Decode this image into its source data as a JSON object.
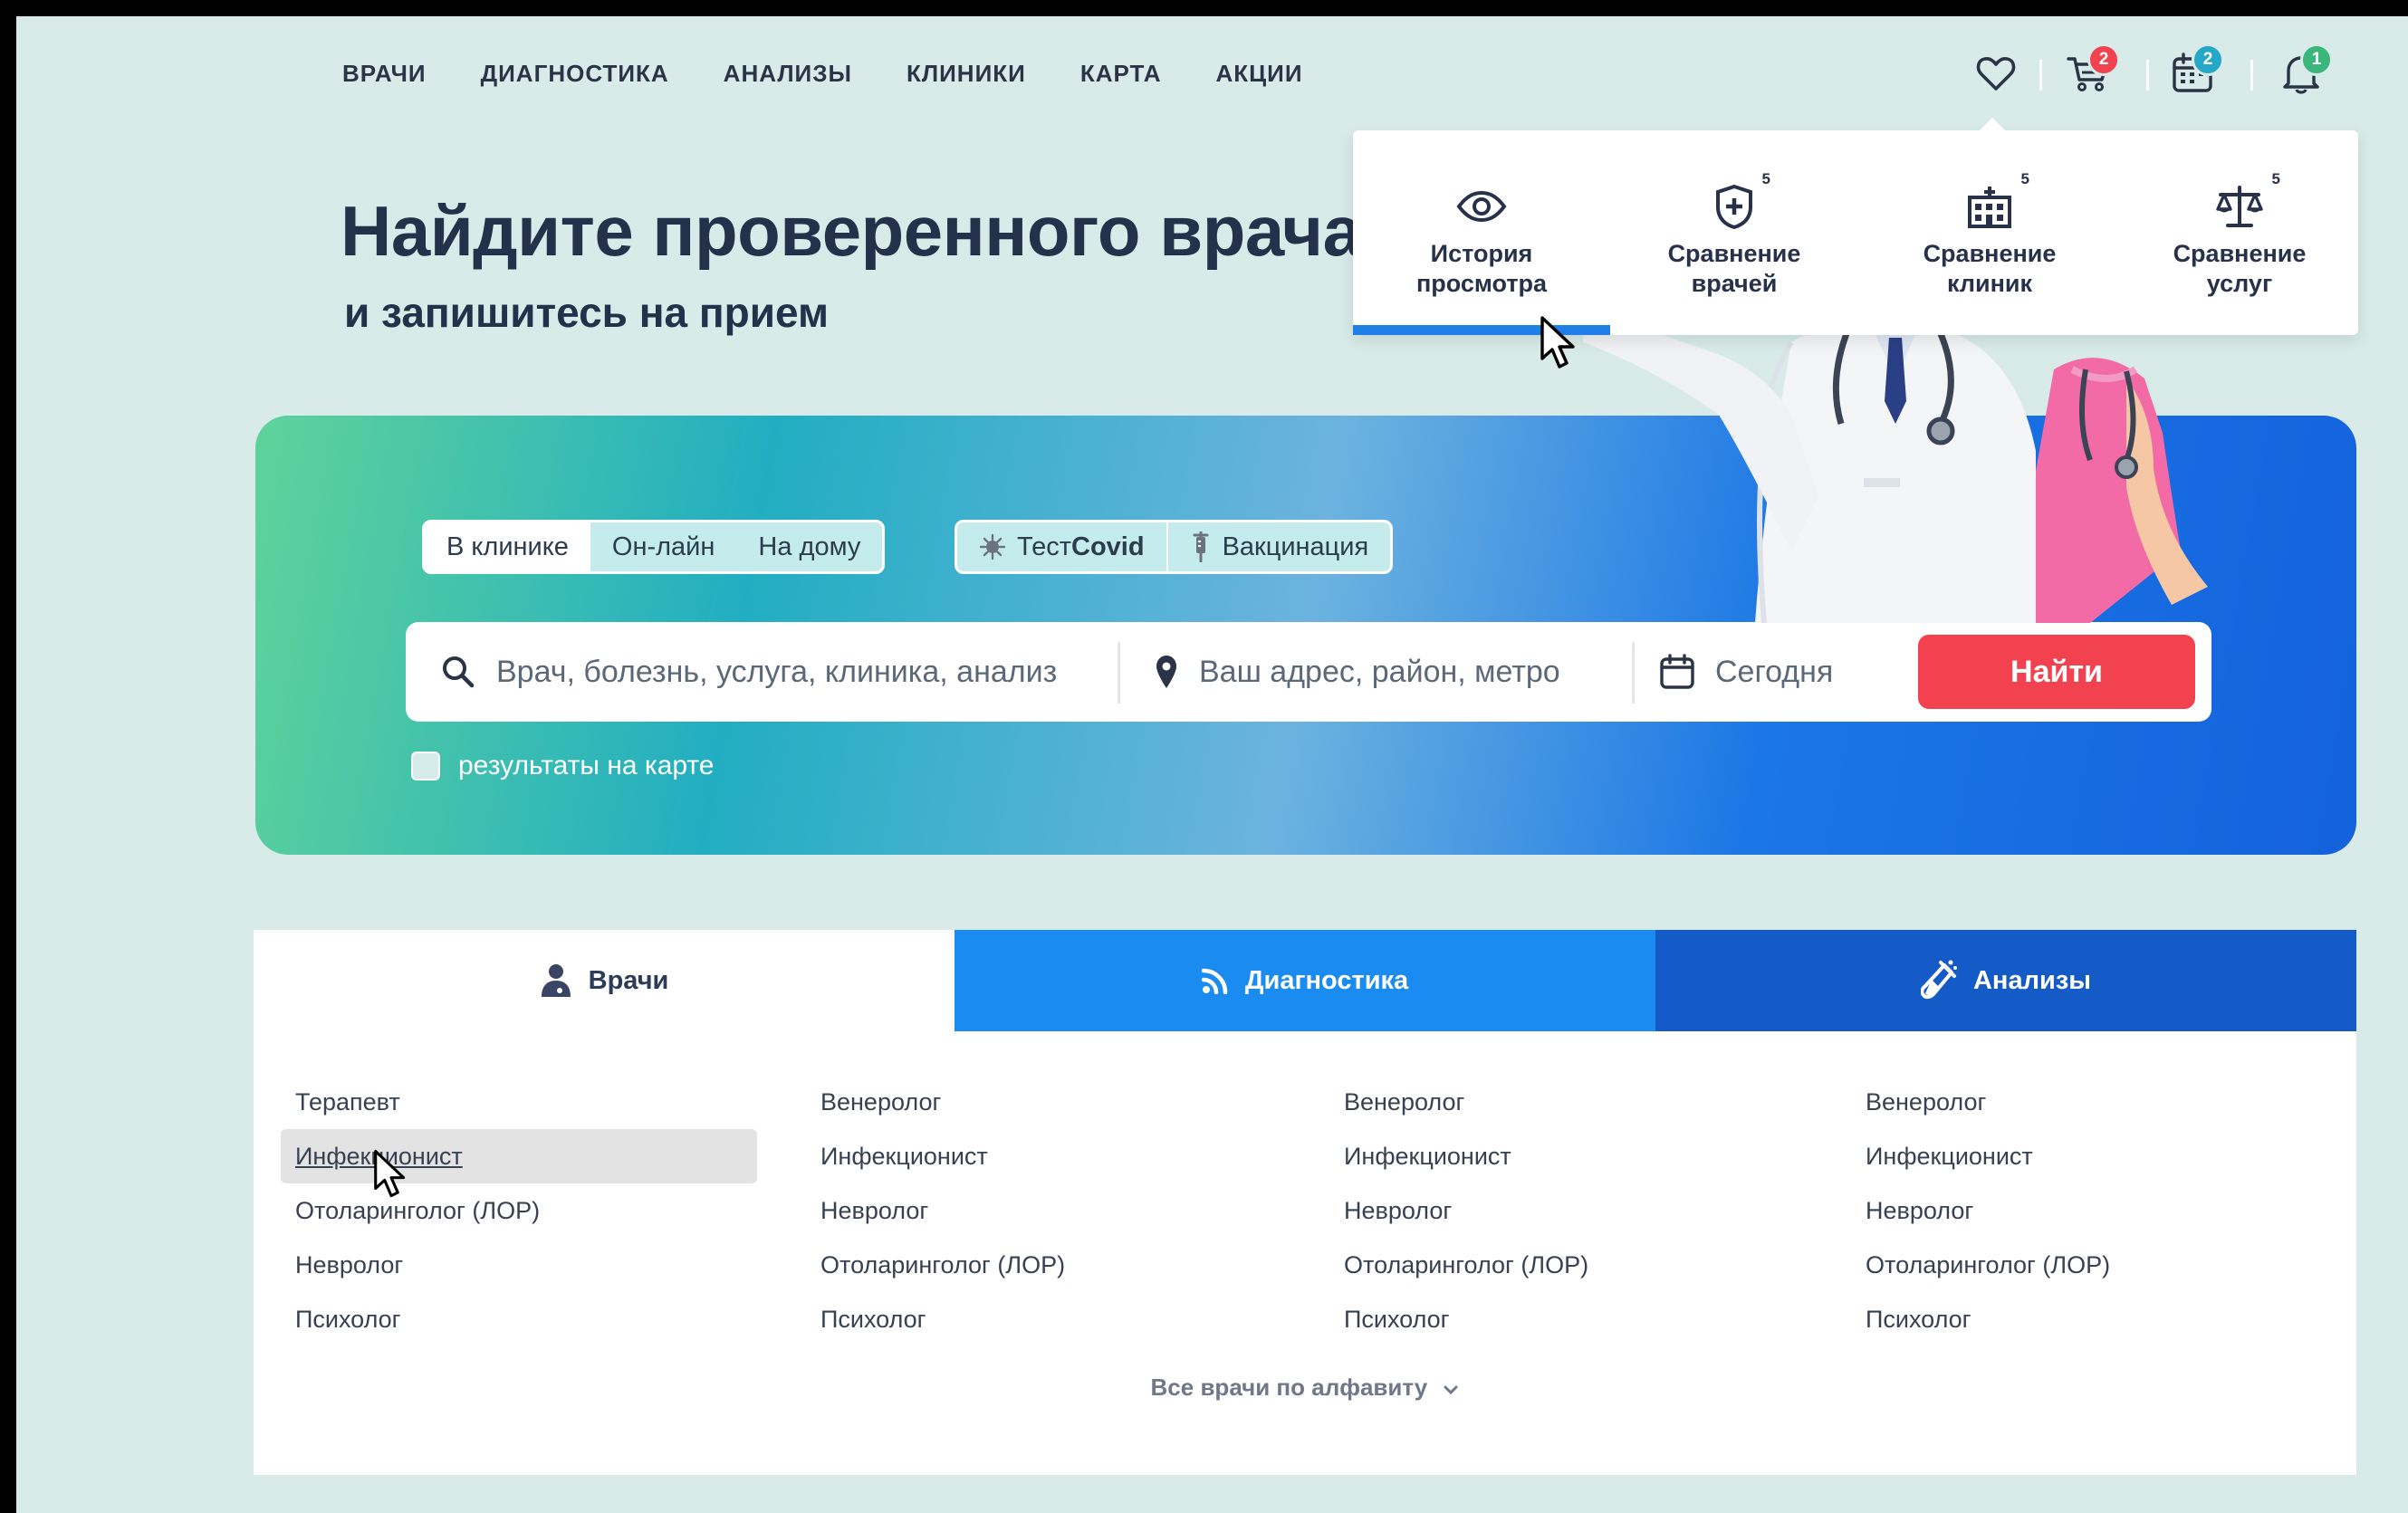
{
  "nav": {
    "items": [
      {
        "label": "ВРАЧИ"
      },
      {
        "label": "ДИАГНОСТИКА"
      },
      {
        "label": "АНАЛИЗЫ"
      },
      {
        "label": "КЛИНИКИ"
      },
      {
        "label": "КАРТА"
      },
      {
        "label": "АКЦИИ"
      }
    ]
  },
  "top_icons": {
    "favorites_icon": "heart-icon",
    "cart": {
      "icon": "cart-icon",
      "badge": "2",
      "badge_color": "#f0424f"
    },
    "calendar": {
      "icon": "calendar-icon",
      "badge": "2",
      "badge_color": "#25a8c8"
    },
    "notifications": {
      "icon": "bell-icon",
      "badge": "1",
      "badge_color": "#3ab67a"
    }
  },
  "hero": {
    "title": "Найдите проверенного врача",
    "subtitle": "и запишитесь на прием"
  },
  "compare_menu": {
    "items": [
      {
        "label_line1": "История",
        "label_line2": "просмотра",
        "icon": "eye-icon",
        "count": "",
        "active": true
      },
      {
        "label_line1": "Сравнение",
        "label_line2": "врачей",
        "icon": "medical-shield-icon",
        "count": "5"
      },
      {
        "label_line1": "Сравнение",
        "label_line2": "клиник",
        "icon": "hospital-icon",
        "count": "5"
      },
      {
        "label_line1": "Сравнение",
        "label_line2": "услуг",
        "icon": "scales-icon",
        "count": "5"
      }
    ]
  },
  "search": {
    "visit_types": [
      {
        "label": "В клинике",
        "active": true
      },
      {
        "label": "Он-лайн"
      },
      {
        "label": "На дому"
      }
    ],
    "quick": [
      {
        "label_prefix": "Тест ",
        "label_bold": "Covid",
        "icon": "virus-icon"
      },
      {
        "label_prefix": "Вакцинация",
        "label_bold": "",
        "icon": "syringe-icon"
      }
    ],
    "query_placeholder": "Врач, болезнь, услуга, клиника, анализ",
    "address_placeholder": "Ваш адрес, район, метро",
    "date_value": "Сегодня",
    "submit_label": "Найти",
    "map_results_label": "результаты на карте",
    "accent_color": "#f3424f"
  },
  "category_tabs": [
    {
      "label": "Врачи",
      "icon": "doctor-icon",
      "active": true
    },
    {
      "label": "Диагностика",
      "icon": "rss-icon"
    },
    {
      "label": "Анализы",
      "icon": "test-tube-icon"
    }
  ],
  "specialties": {
    "columns": [
      [
        "Терапевт",
        "Инфекционист",
        "Отоларинголог (ЛОР)",
        "Невролог",
        "Психолог"
      ],
      [
        "Венеролог",
        "Инфекционист",
        "Невролог",
        "Отоларинголог (ЛОР)",
        "Психолог"
      ],
      [
        "Венеролог",
        "Инфекционист",
        "Невролог",
        "Отоларинголог (ЛОР)",
        "Психолог"
      ],
      [
        "Венеролог",
        "Инфекционист",
        "Невролог",
        "Отоларинголог (ЛОР)",
        "Психолог"
      ]
    ],
    "highlighted": "Инфекционист",
    "all_link": "Все врачи по алфавиту"
  }
}
